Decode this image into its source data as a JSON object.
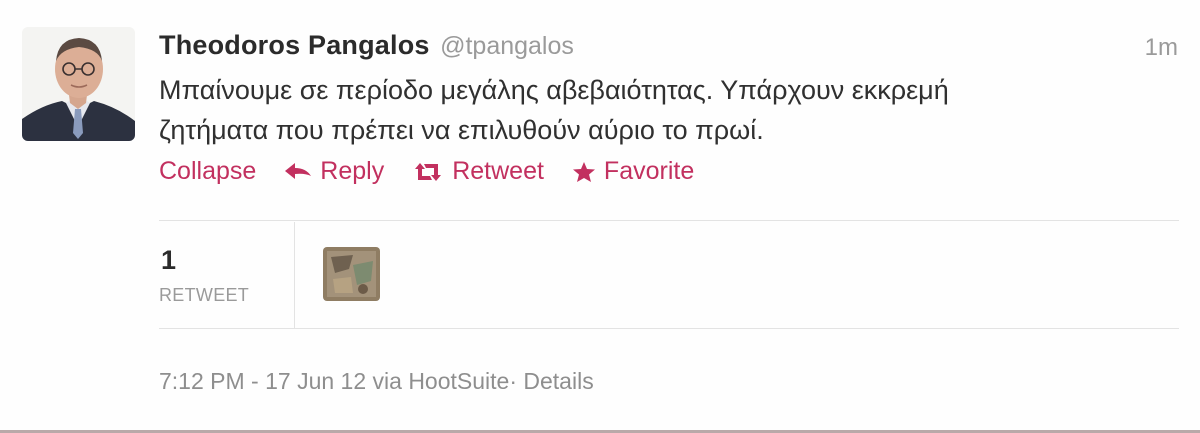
{
  "tweet": {
    "author": {
      "fullname": "Theodoros Pangalos",
      "username": "@tpangalos"
    },
    "timestamp": "1m",
    "text_line1": "Μπαίνουμε σε περίοδο μεγάλης αβεβαιότητας. Υπάρχουν εκκρεμή",
    "text_line2": "ζητήματα που πρέπει να επιλυθούν αύριο το πρωί.",
    "actions": {
      "collapse": "Collapse",
      "reply": "Reply",
      "retweet": "Retweet",
      "favorite": "Favorite"
    },
    "stats": {
      "retweet_count": "1",
      "retweet_label": "RETWEET"
    },
    "footer": {
      "time": "7:12 PM - 17 Jun 12",
      "via_prefix": "via",
      "client": "HootSuite",
      "separator": "·",
      "details": "Details"
    }
  },
  "colors": {
    "action": "#c2305f",
    "name": "#2b2b2b",
    "muted": "#9a9a9a"
  },
  "icons": {
    "reply": "reply-arrow-icon",
    "retweet": "retweet-icon",
    "favorite": "star-icon"
  }
}
